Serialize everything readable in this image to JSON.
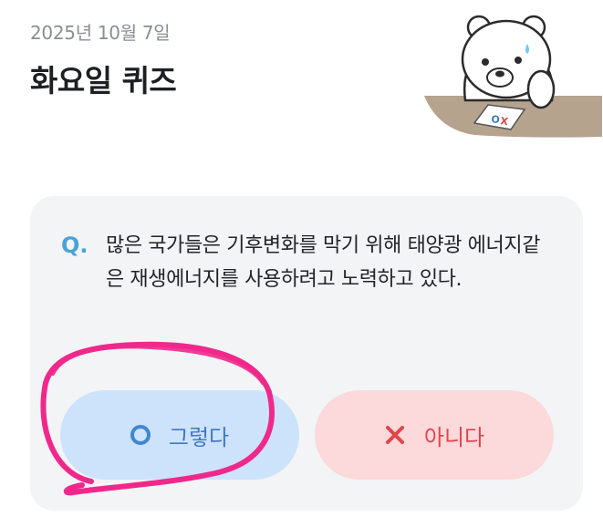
{
  "header": {
    "date": "2025년 10월 7일",
    "title": "화요일 퀴즈"
  },
  "quiz": {
    "q_mark": "Q.",
    "question": "많은 국가들은 기후변화를 막기 위해 태양광 에너지같은 재생에너지를 사용하려고 노력하고 있다.",
    "mascot_sign": "OX",
    "answers": {
      "yes_label": "그렇다",
      "yes_icon": "circle-o-icon",
      "no_label": "아니다",
      "no_icon": "x-icon"
    }
  },
  "colors": {
    "yes_bg": "#cde3fb",
    "yes_text": "#3f78c4",
    "no_bg": "#fcd9da",
    "no_text": "#e0454c",
    "card_bg": "#f2f4f6",
    "highlight_stroke": "#f0288c"
  },
  "annotation": {
    "type": "hand-drawn-circle",
    "target": "yes-button"
  }
}
